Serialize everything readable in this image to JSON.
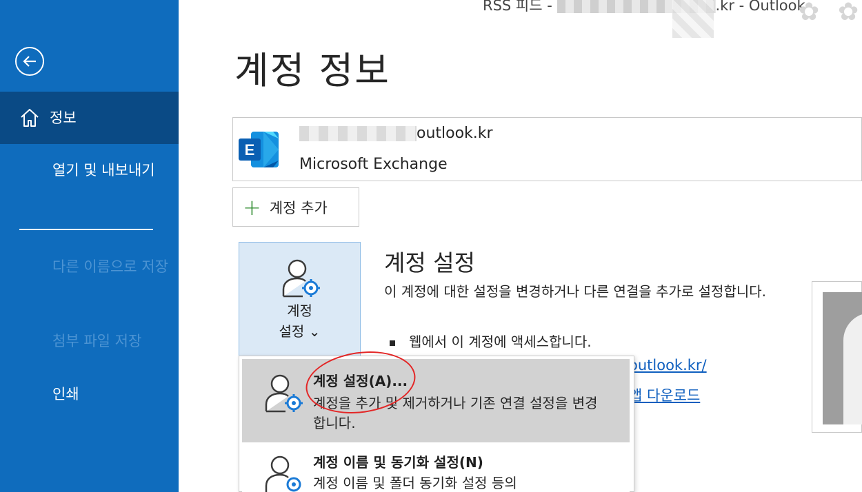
{
  "window": {
    "title_prefix": "RSS 피드 - ",
    "title_suffix": ".kr  -  Outlook"
  },
  "sidebar": {
    "back_icon": "arrow-left-circle-icon",
    "items": [
      {
        "label": "정보",
        "icon": "home-icon",
        "selected": true
      },
      {
        "label": "열기 및 내보내기"
      },
      {
        "label": "다른 이름으로 저장",
        "disabled": true
      },
      {
        "label": "첨부 파일 저장",
        "disabled": true
      },
      {
        "label": "인쇄"
      }
    ]
  },
  "main": {
    "page_title": "계정 정보",
    "account": {
      "email_suffix": "outlook.kr",
      "type": "Microsoft Exchange",
      "icon": "exchange-logo-icon"
    },
    "add_account_label": "계정 추가",
    "settings_tile": {
      "label_line1": "계정",
      "label_line2": "설정 ⌄"
    },
    "section": {
      "title": "계정 설정",
      "description": "이 계정에 대한 설정을 변경하거나 다른 연결을 추가로 설정합니다.",
      "bullet": "웹에서 이 계정에 액세스합니다.",
      "link1": "outlook.kr/",
      "link2": "앱 다운로드"
    },
    "dropdown": [
      {
        "title": "계정 설정(A)...",
        "description": "계정을 추가 및 제거하거나 기존 연결 설정을 변경합니다.",
        "highlighted": true
      },
      {
        "title": "계정 이름 및 동기화 설정(N)",
        "description": "계정 이름 및 폴더 동기화 설정 등의"
      }
    ]
  },
  "colors": {
    "sidebar_bg": "#0f6cbd",
    "sidebar_selected": "#0a4a85",
    "link": "#0f5fbf",
    "annotation": "#e32626"
  }
}
